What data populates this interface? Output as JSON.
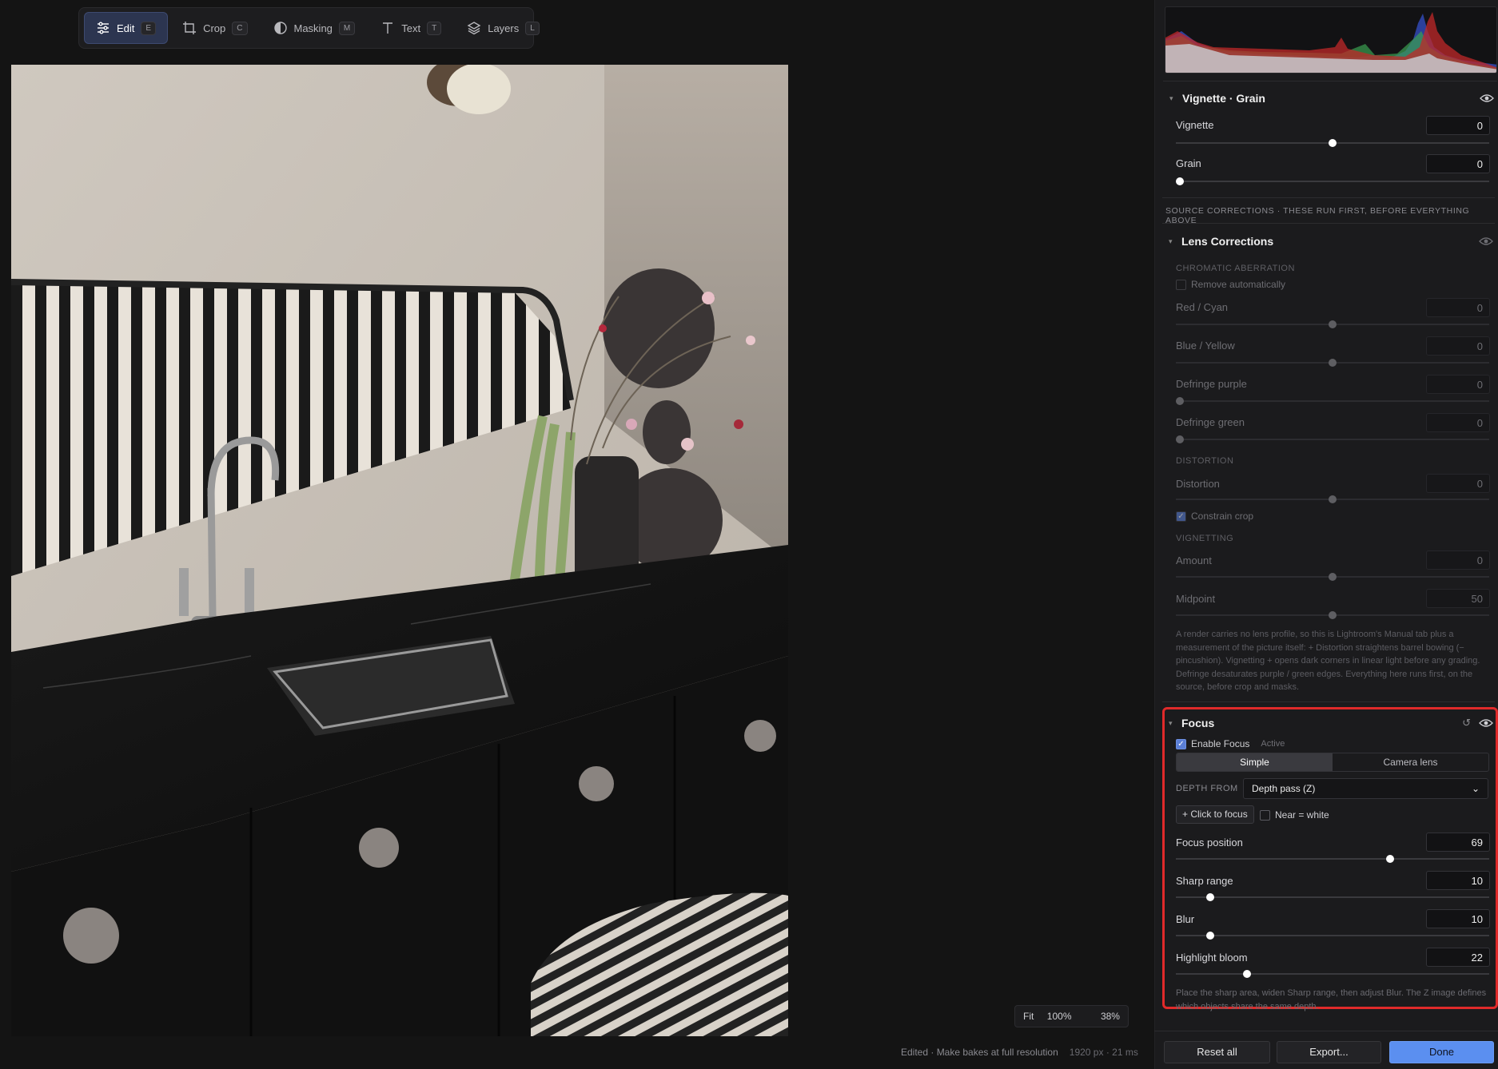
{
  "toolbar": {
    "items": [
      {
        "label": "Edit",
        "key": "E",
        "active": true,
        "icon": "sliders-icon"
      },
      {
        "label": "Crop",
        "key": "C",
        "active": false,
        "icon": "crop-icon"
      },
      {
        "label": "Masking",
        "key": "M",
        "active": false,
        "icon": "half-circle-icon"
      },
      {
        "label": "Text",
        "key": "T",
        "active": false,
        "icon": "text-icon"
      },
      {
        "label": "Layers",
        "key": "L",
        "active": false,
        "icon": "layers-icon"
      }
    ]
  },
  "zoom": {
    "fit": "Fit",
    "full": "100%",
    "current": "38%"
  },
  "status": {
    "text": "Edited · Make bakes at full resolution",
    "meta": "1920 px · 21 ms"
  },
  "panel": {
    "vignette_grain": {
      "title": "Vignette · Grain",
      "vignette": {
        "label": "Vignette",
        "value": "0",
        "level": 0.5
      },
      "grain": {
        "label": "Grain",
        "value": "0",
        "level": 0.0
      }
    },
    "source_corrections": "SOURCE CORRECTIONS · THESE RUN FIRST, BEFORE EVERYTHING ABOVE",
    "lens": {
      "title": "Lens Corrections",
      "chromatic_heading": "CHROMATIC ABERRATION",
      "remove_auto": "Remove automatically",
      "red_cyan": {
        "label": "Red / Cyan",
        "value": "0"
      },
      "blue_yellow": {
        "label": "Blue / Yellow",
        "value": "0"
      },
      "defringe_purple": {
        "label": "Defringe purple",
        "value": "0"
      },
      "defringe_green": {
        "label": "Defringe green",
        "value": "0"
      },
      "distortion_heading": "DISTORTION",
      "distortion": {
        "label": "Distortion",
        "value": "0"
      },
      "constrain_crop": "Constrain crop",
      "vignetting_heading": "VIGNETTING",
      "amount": {
        "label": "Amount",
        "value": "0"
      },
      "midpoint": {
        "label": "Midpoint",
        "value": "50"
      },
      "note": "A render carries no lens profile, so this is Lightroom's Manual tab plus a measurement of the picture itself: + Distortion straightens barrel bowing (− pincushion). Vignetting + opens dark corners in linear light before any grading. Defringe desaturates purple / green edges. Everything here runs first, on the source, before crop and masks."
    },
    "focus": {
      "title": "Focus",
      "enable": "Enable Focus",
      "active": "Active",
      "mode_simple": "Simple",
      "mode_camera": "Camera lens",
      "depth_from": "DEPTH FROM",
      "depth_value": "Depth pass (Z)",
      "click_to_focus": "+ Click to focus",
      "near_white": "Near = white",
      "focus_position": {
        "label": "Focus position",
        "value": "69"
      },
      "sharp_range": {
        "label": "Sharp range",
        "value": "10"
      },
      "blur": {
        "label": "Blur",
        "value": "10"
      },
      "highlight_bloom": {
        "label": "Highlight bloom",
        "value": "22"
      },
      "note": "Place the sharp area, widen Sharp range, then adjust Blur. The Z image defines which objects share the same depth."
    },
    "footer": {
      "reset": "Reset all",
      "export": "Export...",
      "done": "Done"
    }
  },
  "colors": {
    "accent": "#5b8ff0",
    "highlight_border": "#e02a2a"
  }
}
